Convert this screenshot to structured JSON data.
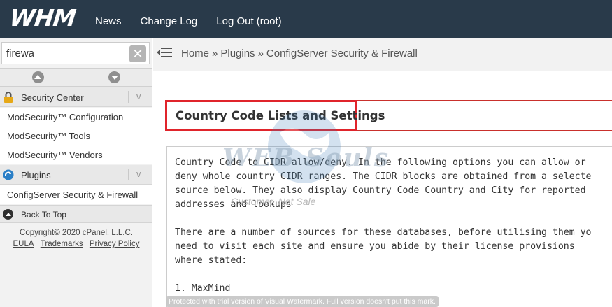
{
  "topbar": {
    "logo": "WHM",
    "nav": [
      "News",
      "Change Log",
      "Log Out (root)"
    ]
  },
  "sidebar": {
    "search": {
      "value": "firewa",
      "clear_icon": "close-icon"
    },
    "sections": [
      {
        "label": "Security Center",
        "icon": "lock-icon",
        "chevron": "v"
      },
      {
        "label": "Plugins",
        "icon": "plugins-icon",
        "chevron": "v"
      }
    ],
    "security_items": [
      "ModSecurity™ Configuration",
      "ModSecurity™ Tools",
      "ModSecurity™ Vendors"
    ],
    "plugin_items": [
      "ConfigServer Security & Firewall"
    ],
    "back_to_top": "Back To Top",
    "copyright_prefix": "Copyright© 2020",
    "copyright_company": "cPanel, L.L.C.",
    "footer_links": [
      "EULA",
      "Trademarks",
      "Privacy Policy"
    ]
  },
  "breadcrumb": {
    "items": [
      "Home",
      "Plugins",
      "ConfigServer Security & Firewall"
    ],
    "separator": "»"
  },
  "main": {
    "heading": "Country Code Lists and Settings",
    "body_lines": [
      "Country Code to CIDR allow/deny. In the following options you can allow or",
      "deny whole country CIDR ranges. The CIDR blocks are obtained from a selecte",
      "source below. They also display Country Code Country and City for reported",
      "addresses and lookups",
      "",
      "There are a number of sources for these databases, before utilising them yo",
      "need to visit each site and ensure you abide by their license provisions",
      "where stated:",
      "",
      "1. MaxMind"
    ]
  },
  "watermark": {
    "text": "WEB Souls",
    "tagline": "Customer, Not Sale",
    "trial_notice": "Protected with trial version of Visual Watermark. Full version doesn't put this mark."
  },
  "colors": {
    "topbar": "#293a4a",
    "highlight_border": "#e0242b"
  }
}
